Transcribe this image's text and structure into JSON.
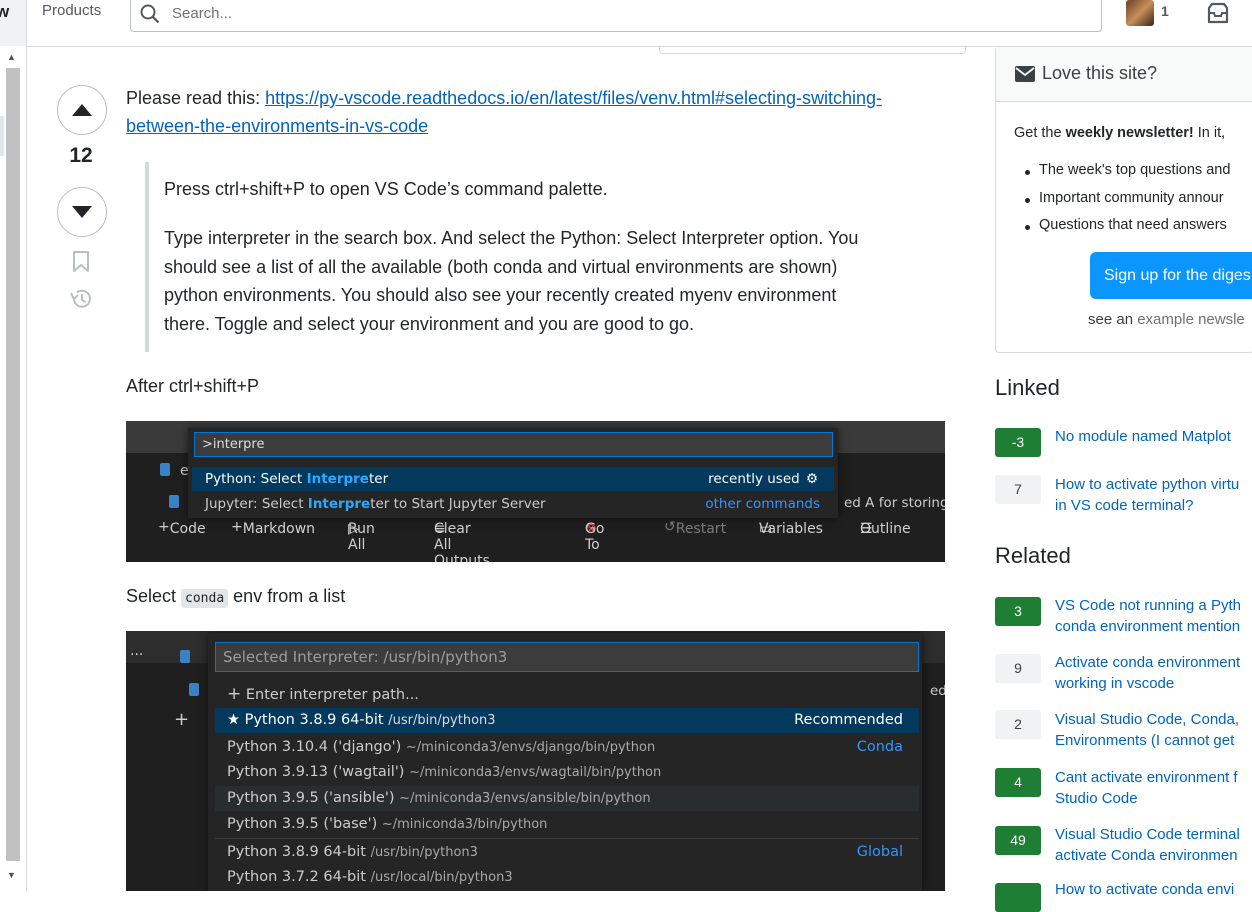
{
  "topbar": {
    "logo_fragment": "w",
    "products_label": "Products",
    "search_placeholder": "Search...",
    "reputation": "1"
  },
  "post": {
    "votes": "12",
    "intro": "Please read this: ",
    "link_line1": "https://py-vscode.readthedocs.io/en/latest/files/venv.html#selecting-switching-",
    "link_line2": "between-the-environments-in-vs-code",
    "quote_p1": "Press ctrl+shift+P to open VS Code’s command palette.",
    "quote_p2_lines": [
      "Type interpreter in the search box. And select the Python: Select Interpreter option. You",
      "should see a list of all the available (both conda and virtual environments are shown)",
      "python environments. You should also see your recently created myenv environment",
      "there. Toggle and select your environment and you are good to go."
    ],
    "after_label": "After ctrl+shift+P",
    "select_before": "Select ",
    "select_code": "conda",
    "select_after": " env from a list"
  },
  "screenshot1": {
    "input_value": ">interpre",
    "rows": [
      {
        "pre": "Python: Select ",
        "hl": "Interpre",
        "post": "ter",
        "right": "recently used"
      },
      {
        "pre": "Jupyter: Select ",
        "hl": "Interpre",
        "post": "ter to Start Jupyter Server",
        "right": "other commands"
      }
    ],
    "bg_text": "ed A for storing",
    "toolbar": [
      "Code",
      "Markdown",
      "Run All",
      "Clear All Outputs",
      "Go To",
      "Restart",
      "Variables",
      "Outline"
    ]
  },
  "screenshot2": {
    "input_placeholder": "Selected Interpreter: /usr/bin/python3",
    "enter_path": "Enter interpreter path...",
    "bg_text": "ed",
    "rows": [
      {
        "name": "Python 3.8.9 64-bit",
        "path": "/usr/bin/python3",
        "group": "Recommended"
      },
      {
        "name": "Python 3.10.4 ('django')",
        "path": "~/miniconda3/envs/django/bin/python",
        "group": "Conda"
      },
      {
        "name": "Python 3.9.13 ('wagtail')",
        "path": "~/miniconda3/envs/wagtail/bin/python",
        "group": ""
      },
      {
        "name": "Python 3.9.5 ('ansible')",
        "path": "~/miniconda3/envs/ansible/bin/python",
        "group": ""
      },
      {
        "name": "Python 3.9.5 ('base')",
        "path": "~/miniconda3/bin/python",
        "group": ""
      },
      {
        "name": "Python 3.8.9 64-bit",
        "path": "/usr/bin/python3",
        "group": "Global"
      },
      {
        "name": "Python 3.7.2 64-bit",
        "path": "/usr/local/bin/python3",
        "group": ""
      }
    ]
  },
  "sidebar": {
    "love_title": "Love this site?",
    "newsletter_pre": "Get the ",
    "newsletter_bold": "weekly newsletter!",
    "newsletter_post": " In it,",
    "bullets": [
      "The week's top questions and",
      "Important community annour",
      "Questions that need answers"
    ],
    "signup_label": "Sign up for the diges",
    "see_an": "see an ",
    "example_link": "example newsle",
    "linked_title": "Linked",
    "linked": [
      {
        "score": "-3",
        "answered": true,
        "lines": [
          "No module named Matplot"
        ]
      },
      {
        "score": "7",
        "answered": false,
        "lines": [
          "How to activate python virtu",
          "in VS code terminal?"
        ]
      }
    ],
    "related_title": "Related",
    "related": [
      {
        "score": "3",
        "answered": true,
        "lines": [
          "VS Code not running a Pyth",
          "conda environment mention"
        ]
      },
      {
        "score": "9",
        "answered": false,
        "lines": [
          "Activate conda environment",
          "working in vscode"
        ]
      },
      {
        "score": "2",
        "answered": false,
        "lines": [
          "Visual Studio Code, Conda,",
          "Environments (I cannot get"
        ]
      },
      {
        "score": "4",
        "answered": true,
        "lines": [
          "Cant activate environment f",
          "Studio Code"
        ]
      },
      {
        "score": "49",
        "answered": true,
        "lines": [
          "Visual Studio Code terminal",
          "activate Conda environmen"
        ]
      },
      {
        "score": "",
        "answered": true,
        "lines": [
          "How to activate conda envi"
        ]
      }
    ]
  },
  "colors": {
    "accent": "#0a95ff",
    "link": "#0063bf",
    "answered": "#1e7e34",
    "vscode_selection": "#04395e"
  }
}
